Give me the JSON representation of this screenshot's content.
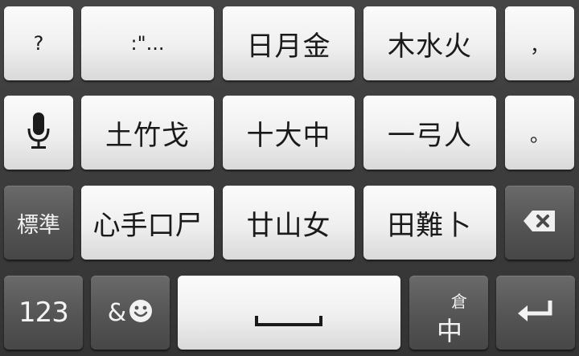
{
  "keyboard": {
    "row1": {
      "question": "?",
      "punct": ":\"...",
      "radicals1": "日月金",
      "radicals2": "木水火",
      "comma": "，"
    },
    "row2": {
      "mic_icon": "microphone-icon",
      "radicals1": "土竹戈",
      "radicals2": "十大中",
      "radicals3": "一弓人",
      "period": "。"
    },
    "row3": {
      "mode": "標準",
      "radicals1": "心手口尸",
      "radicals2": "廿山女",
      "radicals3": "田難卜",
      "backspace_icon": "backspace-icon"
    },
    "row4": {
      "numbers": "123",
      "symbols_amp": "&",
      "emoji_icon": "smiley-icon",
      "space_icon": "space-bar-icon",
      "input_mode_top": "倉",
      "input_mode_main": "中",
      "enter_icon": "enter-arrow-icon"
    }
  }
}
